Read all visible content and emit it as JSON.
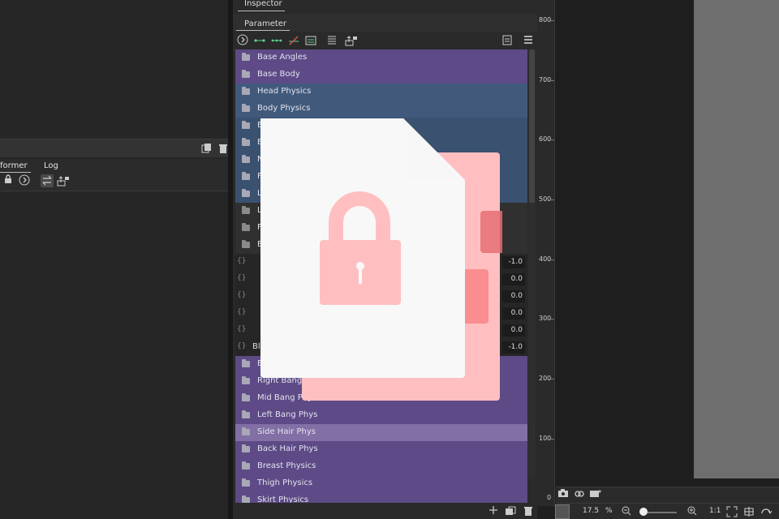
{
  "left_panel": {
    "tabs": [
      "former",
      "Log"
    ]
  },
  "inspector": {
    "title": "Inspector",
    "panel_title": "Parameter"
  },
  "parameter_list": {
    "groups_top": [
      {
        "label": "Base Angles",
        "style": "purple"
      },
      {
        "label": "Base Body",
        "style": "purple"
      },
      {
        "label": "Head Physics",
        "style": "blue"
      },
      {
        "label": "Body Physics",
        "style": "blue"
      },
      {
        "label": "E",
        "style": "blue2"
      },
      {
        "label": "E",
        "style": "blue2"
      },
      {
        "label": "N",
        "style": "blue2"
      },
      {
        "label": "F",
        "style": "blue2"
      },
      {
        "label": "L",
        "style": "blue2"
      },
      {
        "label": "L",
        "style": "dark"
      },
      {
        "label": "F",
        "style": "dark"
      },
      {
        "label": "E",
        "style": "dark"
      }
    ],
    "param_values": [
      "-1.0",
      "0.0",
      "0.0",
      "0.0",
      "0.0",
      "-1.0"
    ],
    "param_tag": "Bl",
    "groups_bottom": [
      {
        "label": "E",
        "style": "purple",
        "selected": false
      },
      {
        "label": "Right Bang Ph",
        "style": "purple",
        "selected": false
      },
      {
        "label": "Mid Bang Phys",
        "style": "purple",
        "selected": false
      },
      {
        "label": "Left Bang Phys",
        "style": "purple",
        "selected": false
      },
      {
        "label": "Side Hair Phys",
        "style": "purple",
        "selected": true
      },
      {
        "label": "Back Hair Phys",
        "style": "purple",
        "selected": false
      },
      {
        "label": "Breast Physics",
        "style": "purple",
        "selected": false
      },
      {
        "label": "Thigh Physics",
        "style": "purple",
        "selected": false
      },
      {
        "label": "Skirt Physics",
        "style": "purple",
        "selected": false
      }
    ]
  },
  "ruler": {
    "labels": [
      "800",
      "700",
      "600",
      "500",
      "400",
      "300",
      "200",
      "100",
      "0"
    ]
  },
  "viewport": {
    "zoom_value": "17.5",
    "zoom_unit": "%",
    "ratio_label": "1:1"
  },
  "icons": {
    "folder": "folder-icon",
    "lock": "lock-icon",
    "trash": "trash-icon",
    "add": "plus-icon",
    "camera": "camera-icon"
  },
  "colors": {
    "purple_row": "#5d4a86",
    "purple_row_selected": "#826fa6",
    "blue_row": "#415a7c",
    "overlay_pink": "#ffbfc1",
    "overlay_sheet": "#f8f8f9"
  }
}
